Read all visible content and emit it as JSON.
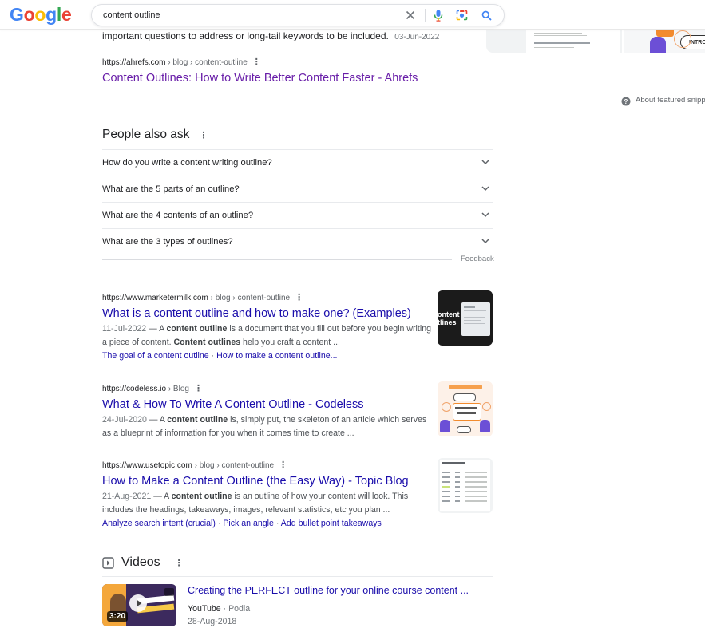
{
  "search": {
    "query": "content outline"
  },
  "logo": {
    "letters": [
      "G",
      "o",
      "o",
      "g",
      "l",
      "e"
    ],
    "colors": [
      "#4285f4",
      "#ea4335",
      "#fbbc05",
      "#4285f4",
      "#34a853",
      "#ea4335"
    ]
  },
  "top_result": {
    "snippet_tail": "important questions to address or long-tail keywords to be included.",
    "date": "03-Jun-2022",
    "cite_domain": "https://ahrefs.com",
    "cite_path": " › blog › content-outline",
    "title": "Content Outlines: How to Write Better Content Faster - Ahrefs",
    "about_featured": "About featured snippe"
  },
  "people_also_ask": {
    "heading": "People also ask",
    "questions": [
      "How do you write a content writing outline?",
      "What are the 5 parts of an outline?",
      "What are the 4 contents of an outline?",
      "What are the 3 types of outlines?"
    ],
    "feedback": "Feedback"
  },
  "results": [
    {
      "cite_domain": "https://www.marketermilk.com",
      "cite_path": " › blog › content-outline",
      "title": "What is a content outline and how to make one? (Examples)",
      "date": "11-Jul-2022",
      "line1_a": " — A ",
      "line1_b": "content outline",
      "line1_c": " is a document that you fill out before you begin writing",
      "line2_a": "a piece of content. ",
      "line2_b": "Content outlines",
      "line2_c": " help you craft a content ...",
      "sitelinks": [
        "The goal of a content outline",
        "How to make a content outline..."
      ],
      "thumb_text": "ontent\ntlines"
    },
    {
      "cite_domain": "https://codeless.io",
      "cite_path": " › Blog",
      "title": "What & How To Write A Content Outline - Codeless",
      "date": "24-Jul-2020",
      "line1_a": " — A ",
      "line1_b": "content outline",
      "line1_c": " is, simply put, the skeleton of an article which serves",
      "line2": "as a blueprint of information for you when it comes time to create ..."
    },
    {
      "cite_domain": "https://www.usetopic.com",
      "cite_path": " › blog › content-outline",
      "title": "How to Make a Content Outline (the Easy Way) - Topic Blog",
      "date": "21-Aug-2021",
      "line1_a": " — A ",
      "line1_b": "content outline",
      "line1_c": " is an outline of how your content will look. This",
      "line2": "includes the headings, takeaways, images, relevant statistics, etc you plan ...",
      "sitelinks": [
        "Analyze search intent (crucial)",
        "Pick an angle",
        "Add bullet point takeaways"
      ]
    }
  ],
  "videos": {
    "heading": "Videos",
    "items": [
      {
        "title": "Creating the PERFECT outline for your online course content ...",
        "source": "YouTube",
        "channel": "Podia",
        "date": "28-Aug-2018",
        "duration": "3:20"
      }
    ]
  }
}
